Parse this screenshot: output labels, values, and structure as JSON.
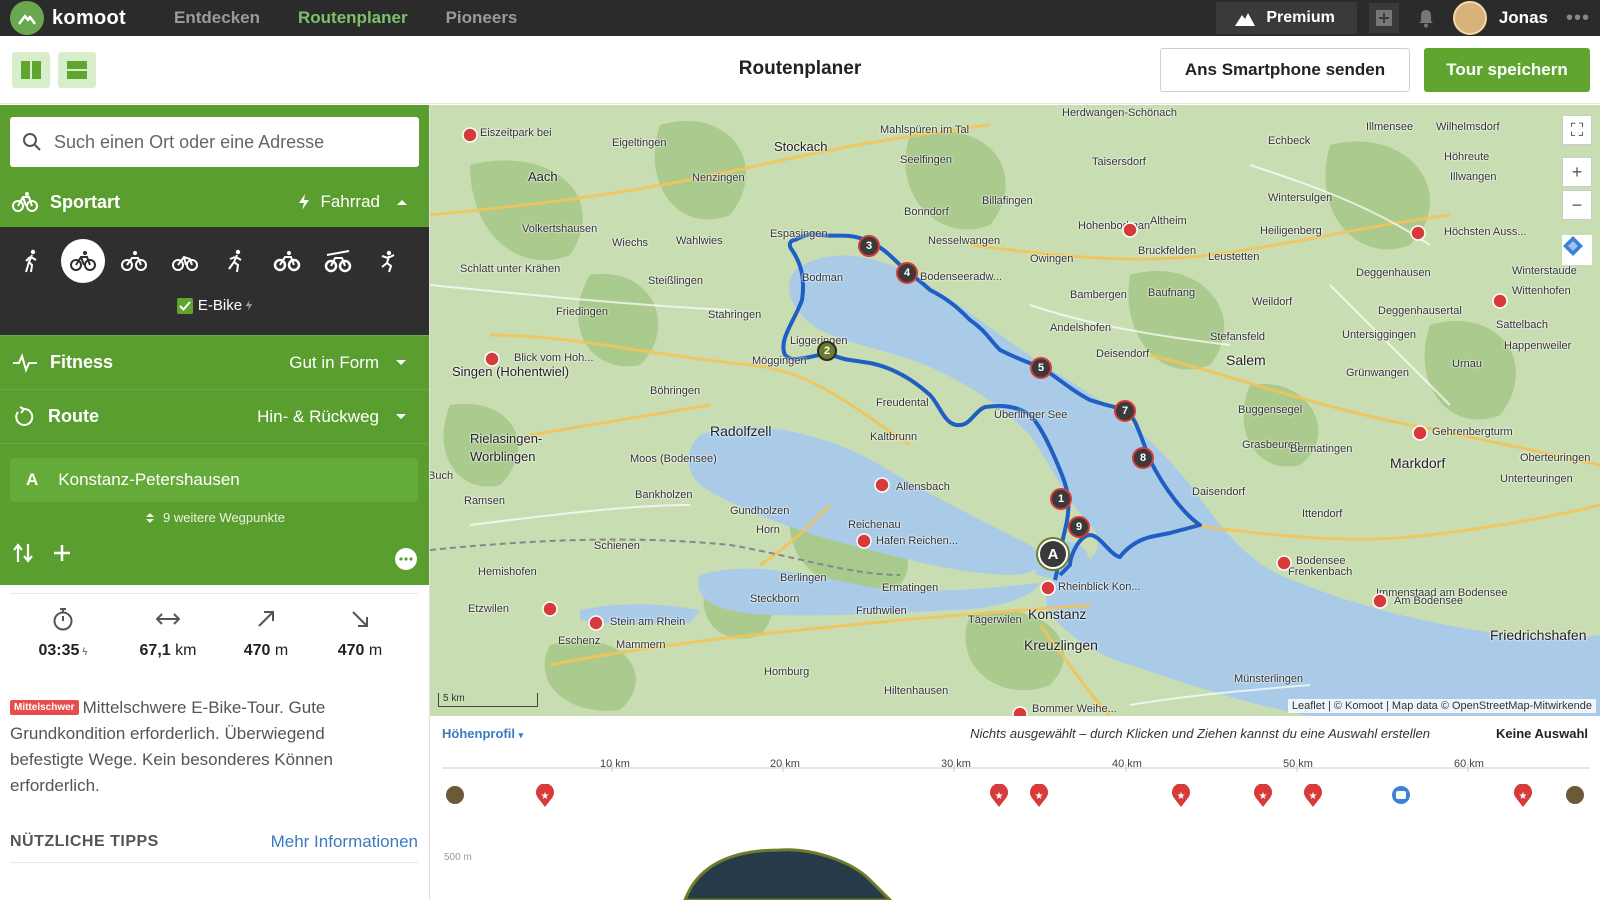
{
  "topbar": {
    "brand": "komoot",
    "nav": [
      "Entdecken",
      "Routenplaner",
      "Pioneers"
    ],
    "active_nav": "Routenplaner",
    "premium_label": "Premium",
    "user_name": "Jonas",
    "icons": [
      "mountain-icon",
      "plus-square-icon",
      "bell-icon",
      "more-icon"
    ]
  },
  "header": {
    "title": "Routenplaner",
    "send_label": "Ans Smartphone senden",
    "save_label": "Tour speichern"
  },
  "sidebar": {
    "search_placeholder": "Such einen Ort oder eine Adresse",
    "sport_label": "Sportart",
    "sport_value": "Fahrrad",
    "ebike_label": "E-Bike",
    "fitness_label": "Fitness",
    "fitness_value": "Gut in Form",
    "route_label": "Route",
    "route_value": "Hin- & Rückweg",
    "start_letter": "A",
    "start_name": "Konstanz-Petershausen",
    "waypoints_label": "9 weitere Wegpunkte",
    "stats": {
      "duration": "03:35",
      "distance": "67,1",
      "distance_unit": "km",
      "ascent": "470",
      "ascent_unit": "m",
      "descent": "470",
      "descent_unit": "m"
    },
    "difficulty_badge": "Mittelschwer",
    "description": "Mittelschwere E-Bike-Tour. Gute Grundkondition erforderlich. Überwiegend befestigte Wege. Kein besonderes Können erforderlich.",
    "tips_title": "NÜTZLICHE TIPPS",
    "tips_link": "Mehr Informationen"
  },
  "map": {
    "places": [
      "Eiszeitpark bei",
      "Eigeltingen",
      "Stockach",
      "Aach",
      "Nenzingen",
      "Wahlwies",
      "Espasingen",
      "Volkertshausen",
      "Wiechs",
      "Steißlingen",
      "Schlatt unter Krähen",
      "Friedingen",
      "Stahringen",
      "Blick vom Hoh...",
      "Singen (Hohentwiel)",
      "Böhringen",
      "Rielasingen-",
      "Worblingen",
      "Radolfzell",
      "Moos (Bodensee)",
      "Bankholzen",
      "Gundholzen",
      "Horn",
      "Schienen",
      "Hemishofen",
      "Stein am Rhein",
      "Eschenz",
      "Mammern",
      "Berlingen",
      "Steckborn",
      "Homburg",
      "Ermatingen",
      "Fruthwilen",
      "Tägerwilen",
      "Konstanz",
      "Kreuzlingen",
      "Rheinblick Kon...",
      "Hafen Reichen...",
      "Reichenau",
      "Allensbach",
      "Kaltbrunn",
      "Freudental",
      "Möggingen",
      "Liggeringen",
      "Bodman",
      "Mahlspüren im Tal",
      "Seelfingen",
      "Bonndorf",
      "Billafingen",
      "Nesselwangen",
      "Bodenseeradw...",
      "Owingen",
      "Hohenbodman",
      "Altheim",
      "Bruckfelden",
      "Taisersdorf",
      "Herdwangen-Schönach",
      "Echbeck",
      "Wintersulgen",
      "Heiligenberg",
      "Leustetten",
      "Bambergen",
      "Baufnang",
      "Andelshofen",
      "Deisendorf",
      "Weildorf",
      "Salem",
      "Stefansfeld",
      "Buggensegel",
      "Grasbeuren",
      "Bermatingen",
      "Markdorf",
      "Gehrenbergturm",
      "Daisendorf",
      "Ittendorf",
      "Bodensee",
      "Frenkenbach",
      "Immenstaad am Bodensee",
      "Am Bodensee",
      "Friedrichshafen",
      "Illmensee",
      "Wilhelmsdorf",
      "Höhreute",
      "Illwangen",
      "Höchsten Auss...",
      "Deggenhausen",
      "Deggenhausertal",
      "Wittenhofen",
      "Untersiggingen",
      "Grünwangen",
      "Urnau",
      "Sattelbach",
      "Happenweiler",
      "Winterstaude",
      "Oberteuringen",
      "Unterteuringen",
      "Hiltenhausen",
      "Bommer Weihe...",
      "Münsterlingen",
      "Ramsen",
      "Buch",
      "Etzwilen",
      "Überlinger See"
    ],
    "scale_label": "5 km",
    "attribution": "Leaflet | © Komoot | Map data © OpenStreetMap-Mitwirkende",
    "waypoint_numbers": [
      "2",
      "3",
      "4",
      "5",
      "7",
      "8",
      "1",
      "9"
    ],
    "start_marker": "A"
  },
  "profile": {
    "title": "Höhenprofil",
    "hint": "Nichts ausgewählt – durch Klicken und Ziehen kannst du eine Auswahl erstellen",
    "selection": "Keine Auswahl",
    "km_ticks": [
      "10 km",
      "20 km",
      "30 km",
      "40 km",
      "50 km",
      "60 km"
    ],
    "elevation_label": "500 m"
  },
  "colors": {
    "brand_green": "#5a9e2f",
    "route_blue": "#1f5fc4",
    "lake": "#a9cbe8",
    "poi_red": "#d63a3a"
  }
}
